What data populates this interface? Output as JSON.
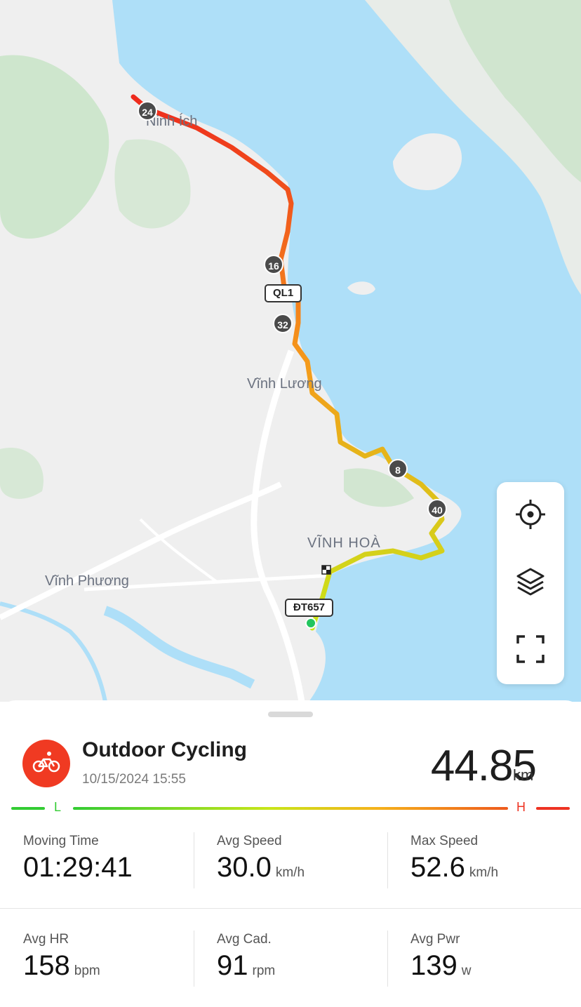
{
  "map": {
    "place_labels": [
      "Ninh Ích",
      "Vĩnh Lương",
      "VĨNH HOÀ",
      "Vĩnh Phương"
    ],
    "road_shields": [
      "QL1",
      "ĐT657"
    ],
    "km_markers": [
      "24",
      "16",
      "32",
      "8",
      "40"
    ],
    "controls": {
      "locate_icon": "crosshair-icon",
      "layers_icon": "layers-icon",
      "fullscreen_icon": "fullscreen-icon"
    },
    "colors": {
      "water": "#aedff8",
      "land": "#efefef",
      "forest": "#c6e3c4",
      "route_fast": "#ee2a1d",
      "route_mid": "#f59a1b",
      "route_slow": "#c8e619"
    }
  },
  "activity": {
    "icon": "bicycle-icon",
    "title": "Outdoor Cycling",
    "date": "10/15/2024 15:55",
    "distance": "44.85",
    "distance_unit": "km",
    "legend_low": "L",
    "legend_high": "H",
    "accent_color": "#f03a22"
  },
  "metrics": [
    {
      "label": "Moving Time",
      "value": "01:29:41",
      "unit": ""
    },
    {
      "label": "Avg Speed",
      "value": "30.0",
      "unit": "km/h"
    },
    {
      "label": "Max Speed",
      "value": "52.6",
      "unit": "km/h"
    },
    {
      "label": "Avg HR",
      "value": "158",
      "unit": "bpm"
    },
    {
      "label": "Avg Cad.",
      "value": "91",
      "unit": "rpm"
    },
    {
      "label": "Avg Pwr",
      "value": "139",
      "unit": "w"
    }
  ]
}
